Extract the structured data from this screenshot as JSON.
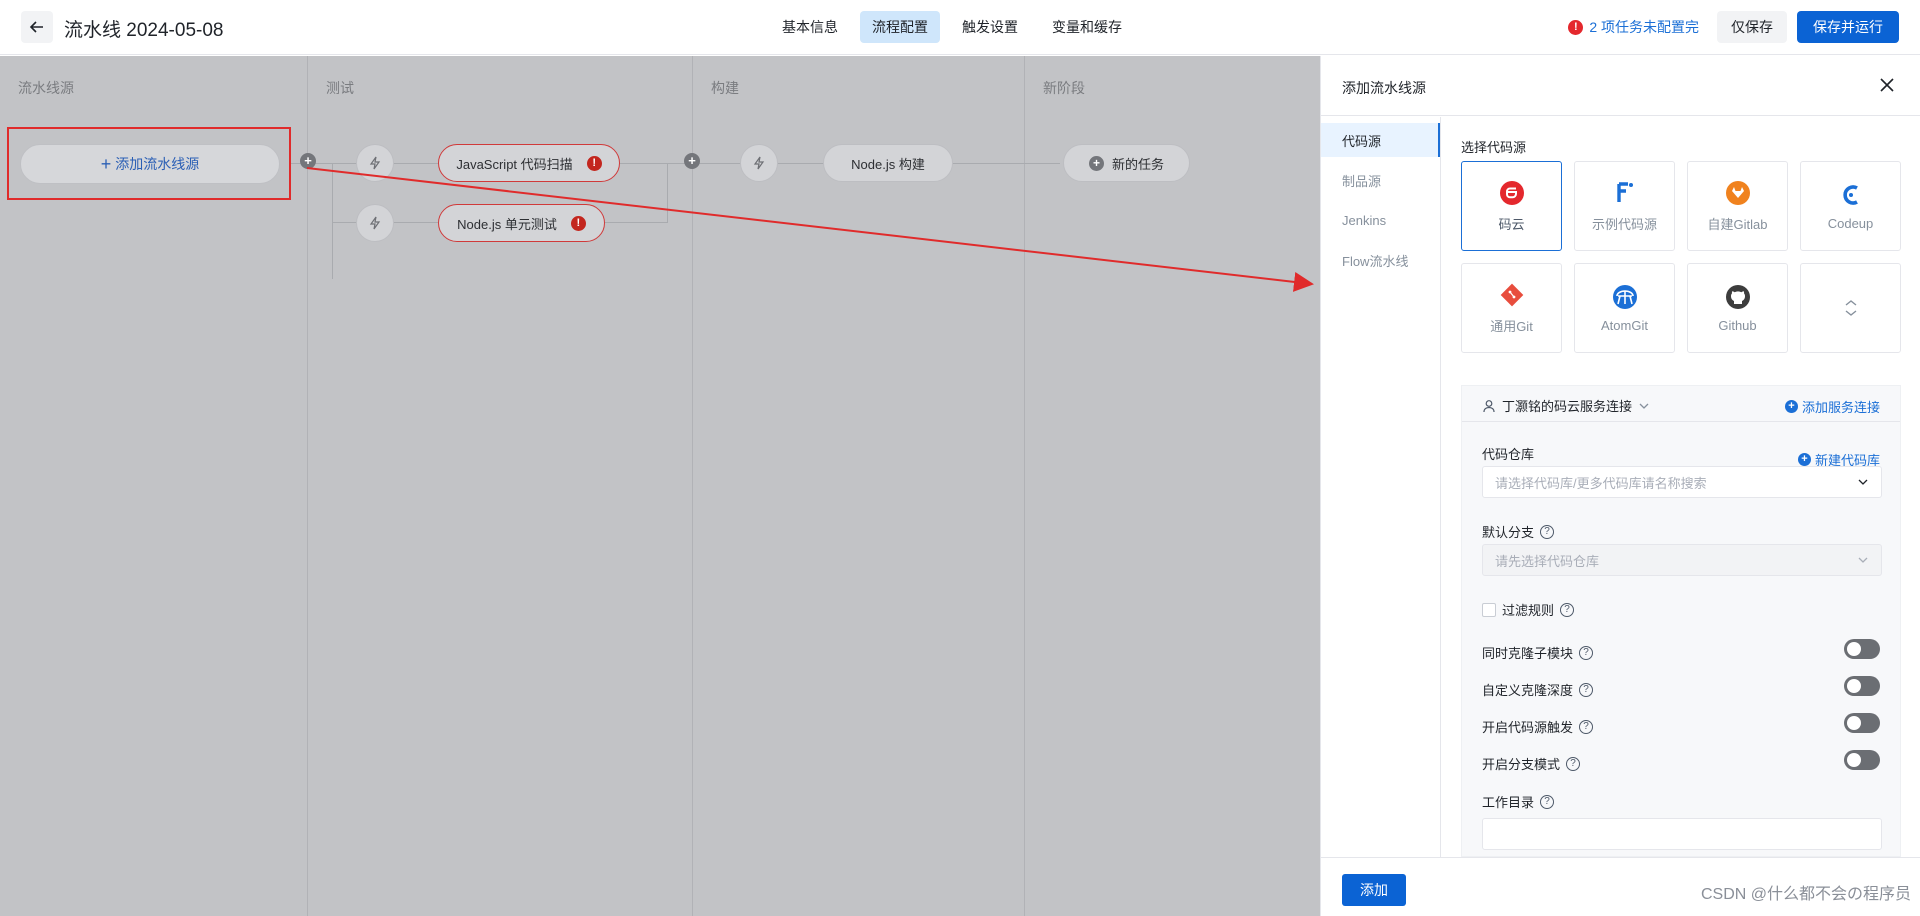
{
  "header": {
    "title": "流水线 2024-05-08",
    "tabs": [
      {
        "label": "基本信息"
      },
      {
        "label": "流程配置"
      },
      {
        "label": "触发设置"
      },
      {
        "label": "变量和缓存"
      }
    ],
    "warning": "2 项任务未配置完",
    "save_only": "仅保存",
    "save_run": "保存并运行"
  },
  "canvas": {
    "stages": [
      {
        "title": "流水线源"
      },
      {
        "title": "测试"
      },
      {
        "title": "构建"
      },
      {
        "title": "新阶段"
      }
    ],
    "add_source": "添加流水线源",
    "tasks": {
      "js_scan": "JavaScript 代码扫描",
      "node_unit": "Node.js 单元测试",
      "node_build": "Node.js 构建",
      "new_task": "新的任务"
    }
  },
  "drawer": {
    "title": "添加流水线源",
    "nav": [
      {
        "label": "代码源"
      },
      {
        "label": "制品源"
      },
      {
        "label": "Jenkins"
      },
      {
        "label": "Flow流水线"
      }
    ],
    "section_label": "选择代码源",
    "sources": [
      {
        "name": "码云",
        "icon": "gitee-icon",
        "color": "#e4282d"
      },
      {
        "name": "示例代码源",
        "icon": "sample-code-icon",
        "color": "#1b6fd6"
      },
      {
        "name": "自建Gitlab",
        "icon": "gitlab-icon",
        "color": "#f0821e"
      },
      {
        "name": "Codeup",
        "icon": "codeup-icon",
        "color": "#1b6fd6"
      },
      {
        "name": "通用Git",
        "icon": "git-icon",
        "color": "#e84d3d"
      },
      {
        "name": "AtomGit",
        "icon": "atomgit-icon",
        "color": "#1b6fd6"
      },
      {
        "name": "Github",
        "icon": "github-icon",
        "color": "#3d3d3d"
      }
    ],
    "connection": {
      "user": "丁灏铭的码云服务连接",
      "add_connection": "添加服务连接",
      "repo_label": "代码仓库",
      "new_repo": "新建代码库",
      "repo_placeholder": "请选择代码库/更多代码库请名称搜索",
      "branch_label": "默认分支",
      "branch_placeholder": "请先选择代码仓库",
      "filter_rules": "过滤规则",
      "toggles": [
        {
          "label": "同时克隆子模块"
        },
        {
          "label": "自定义克隆深度"
        },
        {
          "label": "开启代码源触发"
        },
        {
          "label": "开启分支模式"
        }
      ],
      "workdir_label": "工作目录"
    },
    "add_button": "添加",
    "watermark": "CSDN @什么都不会の程序员"
  }
}
